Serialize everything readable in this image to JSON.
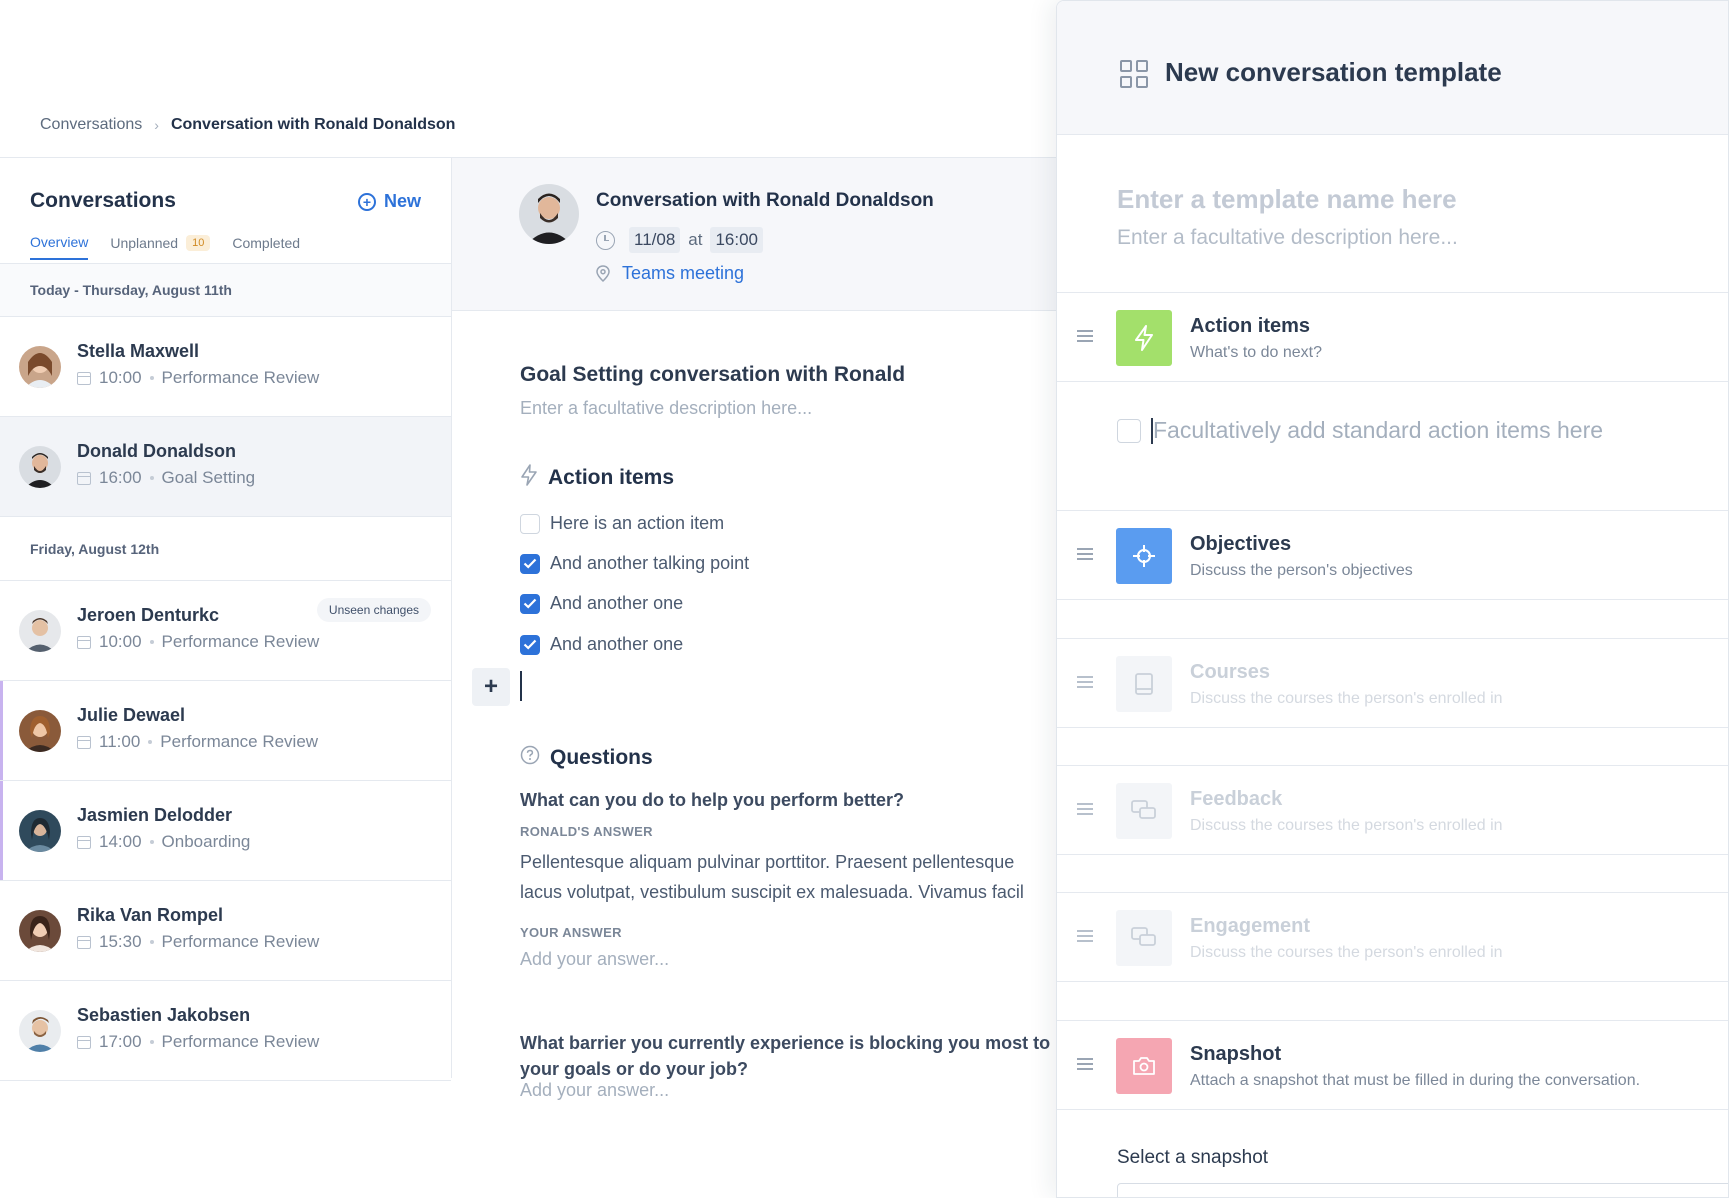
{
  "breadcrumb": {
    "parent": "Conversations",
    "separator": "›",
    "current": "Conversation with Ronald Donaldson"
  },
  "sidebar": {
    "title": "Conversations",
    "new_label": "New",
    "tabs": [
      {
        "label": "Overview",
        "active": true
      },
      {
        "label": "Unplanned",
        "badge": "10"
      },
      {
        "label": "Completed"
      }
    ],
    "groups": [
      {
        "day": "Today - Thursday, August 11th",
        "items": [
          {
            "name": "Stella Maxwell",
            "time": "10:00",
            "type": "Performance Review"
          },
          {
            "name": "Donald Donaldson",
            "time": "16:00",
            "type": "Goal Setting",
            "selected": true
          }
        ]
      },
      {
        "day": "Friday, August 12th",
        "items": [
          {
            "name": "Jeroen Denturkc",
            "time": "10:00",
            "type": "Performance Review",
            "badge": "Unseen changes"
          },
          {
            "name": "Julie Dewael",
            "time": "11:00",
            "type": "Performance Review"
          },
          {
            "name": "Jasmien Delodder",
            "time": "14:00",
            "type": "Onboarding"
          },
          {
            "name": "Rika Van Rompel",
            "time": "15:30",
            "type": "Performance Review"
          },
          {
            "name": "Sebastien Jakobsen",
            "time": "17:00",
            "type": "Performance Review"
          }
        ]
      }
    ]
  },
  "conversation": {
    "title": "Conversation with Ronald Donaldson",
    "date": "11/08",
    "at": "at",
    "time": "16:00",
    "location": "Teams meeting",
    "goal_title": "Goal Setting conversation with Ronald",
    "description_placeholder": "Enter a facultative description here...",
    "action_items_title": "Action items",
    "action_items": [
      {
        "text": "Here is an action item",
        "checked": false
      },
      {
        "text": "And another talking point",
        "checked": true
      },
      {
        "text": "And another one",
        "checked": true
      },
      {
        "text": "And another one",
        "checked": true
      }
    ],
    "add_button": "+",
    "questions_title": "Questions",
    "questions": [
      {
        "question": "What can you do to help you perform better?",
        "their_label": "RONALD'S ANSWER",
        "their_answer_line1": "Pellentesque aliquam pulvinar porttitor. Praesent pellentesque",
        "their_answer_line2": "lacus volutpat, vestibulum suscipit ex malesuada. Vivamus facil",
        "your_label": "YOUR ANSWER",
        "your_placeholder": "Add your answer..."
      },
      {
        "question": "What barrier you currently experience is blocking you most to your goals or do your job?",
        "your_placeholder": "Add your answer..."
      }
    ]
  },
  "template_panel": {
    "title": "New conversation template",
    "name_placeholder": "Enter a template name here",
    "description_placeholder": "Enter a facultative description here...",
    "standard_action_placeholder": "Facultatively add standard action items here",
    "blocks": [
      {
        "title": "Action items",
        "subtitle": "What's to do next?",
        "color": "#a3e06b",
        "icon": "lightning-icon"
      },
      {
        "title": "Objectives",
        "subtitle": "Discuss the person's objectives",
        "color": "#5a9cf0",
        "icon": "target-icon"
      },
      {
        "title": "Courses",
        "subtitle": "Discuss the courses the person's enrolled in",
        "icon": "book-icon",
        "faded": true
      },
      {
        "title": "Feedback",
        "subtitle": "Discuss the courses the person's enrolled in",
        "icon": "chat-icon",
        "faded": true
      },
      {
        "title": "Engagement",
        "subtitle": "Discuss the courses the person's enrolled in",
        "icon": "chat-icon",
        "faded": true
      },
      {
        "title": "Snapshot",
        "subtitle": "Attach a snapshot that must be filled in during the conversation.",
        "color": "#f5a6b2",
        "icon": "camera-icon"
      }
    ],
    "select_label": "Select a snapshot"
  },
  "colors": {
    "accent": "#2d72d9",
    "selected_row": "#f2f4f8",
    "highlight_bar": "#c8b3ef"
  }
}
